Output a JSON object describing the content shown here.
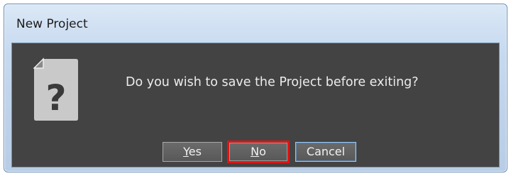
{
  "dialog": {
    "title": "New Project",
    "message": "Do you wish to save the Project before exiting?",
    "icon": "question-mark-document-icon"
  },
  "buttons": {
    "yes_mnemonic": "Y",
    "yes_rest": "es",
    "no_mnemonic": "N",
    "no_rest": "o",
    "cancel_label": "Cancel"
  },
  "colors": {
    "client_background": "#434343",
    "highlight_border": "#e01414"
  }
}
